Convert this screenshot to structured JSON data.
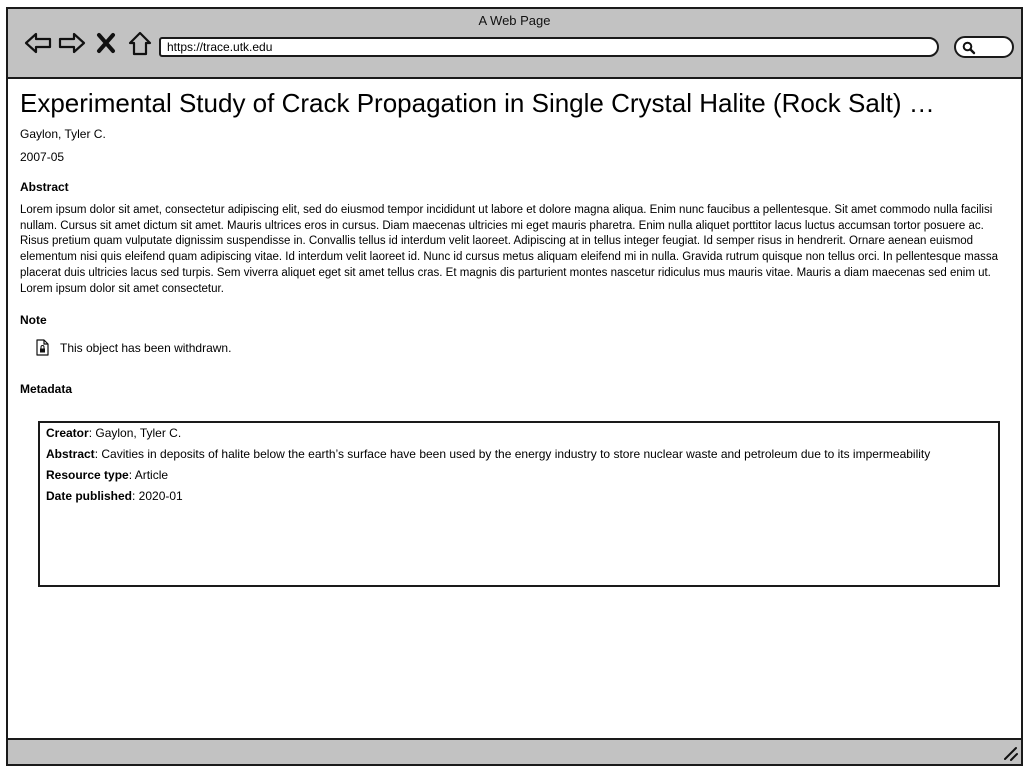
{
  "window": {
    "title": "A Web Page"
  },
  "browser": {
    "url": "https://trace.utk.edu",
    "nav_icons": [
      "back-arrow-icon",
      "forward-arrow-icon",
      "close-x-icon",
      "home-icon"
    ],
    "search_icon": "magnifier-icon"
  },
  "page": {
    "title": "Experimental Study of Crack Propagation in Single Crystal Halite (Rock Salt) …",
    "author": "Gaylon, Tyler C.",
    "date": "2007-05",
    "abstract_label": "Abstract",
    "abstract_text": "Lorem ipsum dolor sit amet, consectetur adipiscing elit, sed do eiusmod tempor incididunt ut labore et dolore magna aliqua. Enim nunc faucibus a pellentesque. Sit amet commodo nulla facilisi nullam. Cursus sit amet dictum sit amet. Mauris ultrices eros in cursus. Diam maecenas ultricies mi eget mauris pharetra. Enim nulla aliquet porttitor lacus luctus accumsan tortor posuere ac. Risus pretium quam vulputate dignissim suspendisse in. Convallis tellus id interdum velit laoreet. Adipiscing at in tellus integer feugiat. Id semper risus in hendrerit. Ornare aenean euismod elementum nisi quis eleifend quam adipiscing vitae. Id interdum velit laoreet id. Nunc id cursus metus aliquam eleifend mi in nulla. Gravida rutrum quisque non tellus orci. In pellentesque massa placerat duis ultricies lacus sed turpis. Sem viverra aliquet eget sit amet tellus cras. Et magnis dis parturient montes nascetur ridiculus mus mauris vitae. Mauris a diam maecenas sed enim ut. Lorem ipsum dolor sit amet consectetur.",
    "note_label": "Note",
    "note_text": "This object has been withdrawn.",
    "note_icon": "document-lock-icon",
    "metadata_label": "Metadata",
    "metadata": [
      {
        "key": "Creator",
        "value": ": Gaylon, Tyler C."
      },
      {
        "key": "Abstract",
        "value": ": Cavities in deposits of halite below the earth’s surface have been used by the energy industry to store nuclear waste and petroleum due to its impermeability"
      },
      {
        "key": "Resource type",
        "value": ": Article"
      },
      {
        "key": "Date published",
        "value": ": 2020-01"
      }
    ]
  },
  "statusbar": {
    "grip_icon": "resize-grip-icon"
  }
}
